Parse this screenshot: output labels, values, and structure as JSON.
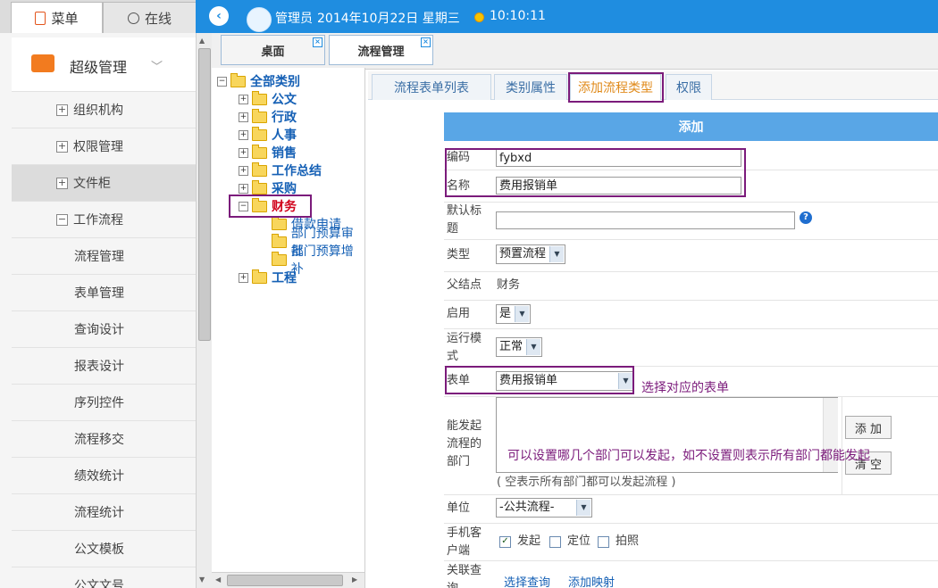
{
  "nav_tabs": {
    "menu": "菜单",
    "online": "在线"
  },
  "header": {
    "user": "管理员",
    "date": "2014年10月22日 星期三",
    "time": "10:10:11",
    "collapse_glyph": "‹"
  },
  "sidebar": {
    "module": "超级管理",
    "items": [
      {
        "label": "组织机构",
        "expander": "+"
      },
      {
        "label": "权限管理",
        "expander": "+"
      },
      {
        "label": "文件柜",
        "expander": "+"
      },
      {
        "label": "工作流程",
        "expander": "−"
      },
      {
        "label": "流程管理"
      },
      {
        "label": "表单管理"
      },
      {
        "label": "查询设计"
      },
      {
        "label": "报表设计"
      },
      {
        "label": "序列控件"
      },
      {
        "label": "流程移交"
      },
      {
        "label": "绩效统计"
      },
      {
        "label": "流程统计"
      },
      {
        "label": "公文模板"
      },
      {
        "label": "公文文号"
      }
    ]
  },
  "doc_tabs": [
    {
      "label": "桌面",
      "close": "×"
    },
    {
      "label": "流程管理",
      "close": "×"
    }
  ],
  "tree": {
    "root": "全部类别",
    "nodes": [
      {
        "label": "公文"
      },
      {
        "label": "行政"
      },
      {
        "label": "人事"
      },
      {
        "label": "销售"
      },
      {
        "label": "工作总结"
      },
      {
        "label": "采购"
      },
      {
        "label": "财务"
      },
      {
        "label": "借款申请"
      },
      {
        "label": "部门预算审批"
      },
      {
        "label": "部门预算增补"
      },
      {
        "label": "工程"
      }
    ]
  },
  "sub_tabs": [
    {
      "label": "流程表单列表"
    },
    {
      "label": "类别属性"
    },
    {
      "label": "添加流程类型"
    },
    {
      "label": "权限"
    }
  ],
  "form": {
    "title": "添加",
    "code_label": "编码",
    "code_value": "fybxd",
    "name_label": "名称",
    "name_value": "费用报销单",
    "default_title_label": "默认标题",
    "type_label": "类型",
    "type_value": "预置流程",
    "parent_label": "父结点",
    "parent_value": "财务",
    "enabled_label": "启用",
    "enabled_value": "是",
    "run_mode_label": "运行模式",
    "run_mode_value": "正常",
    "form_label": "表单",
    "form_value": "费用报销单",
    "form_note": "选择对应的表单",
    "dept_label": "能发起流程的部门",
    "dept_note": "可以设置哪几个部门可以发起，如不设置则表示所有部门都能发起",
    "dept_add_btn": "添 加",
    "dept_clear_btn": "清 空",
    "dept_hint": "( 空表示所有部门都可以发起流程 )",
    "unit_label": "单位",
    "unit_value": "-公共流程-",
    "mobile_label": "手机客户端",
    "mobile_opt1": "发起",
    "mobile_opt2": "定位",
    "mobile_opt3": "拍照",
    "related_label": "关联查询",
    "related_link1": "选择查询",
    "related_link2": "添加映射"
  },
  "colors": {
    "accent": "#1f8de0",
    "highlight": "#7b1b7b",
    "tab_active": "#e08a1a"
  }
}
